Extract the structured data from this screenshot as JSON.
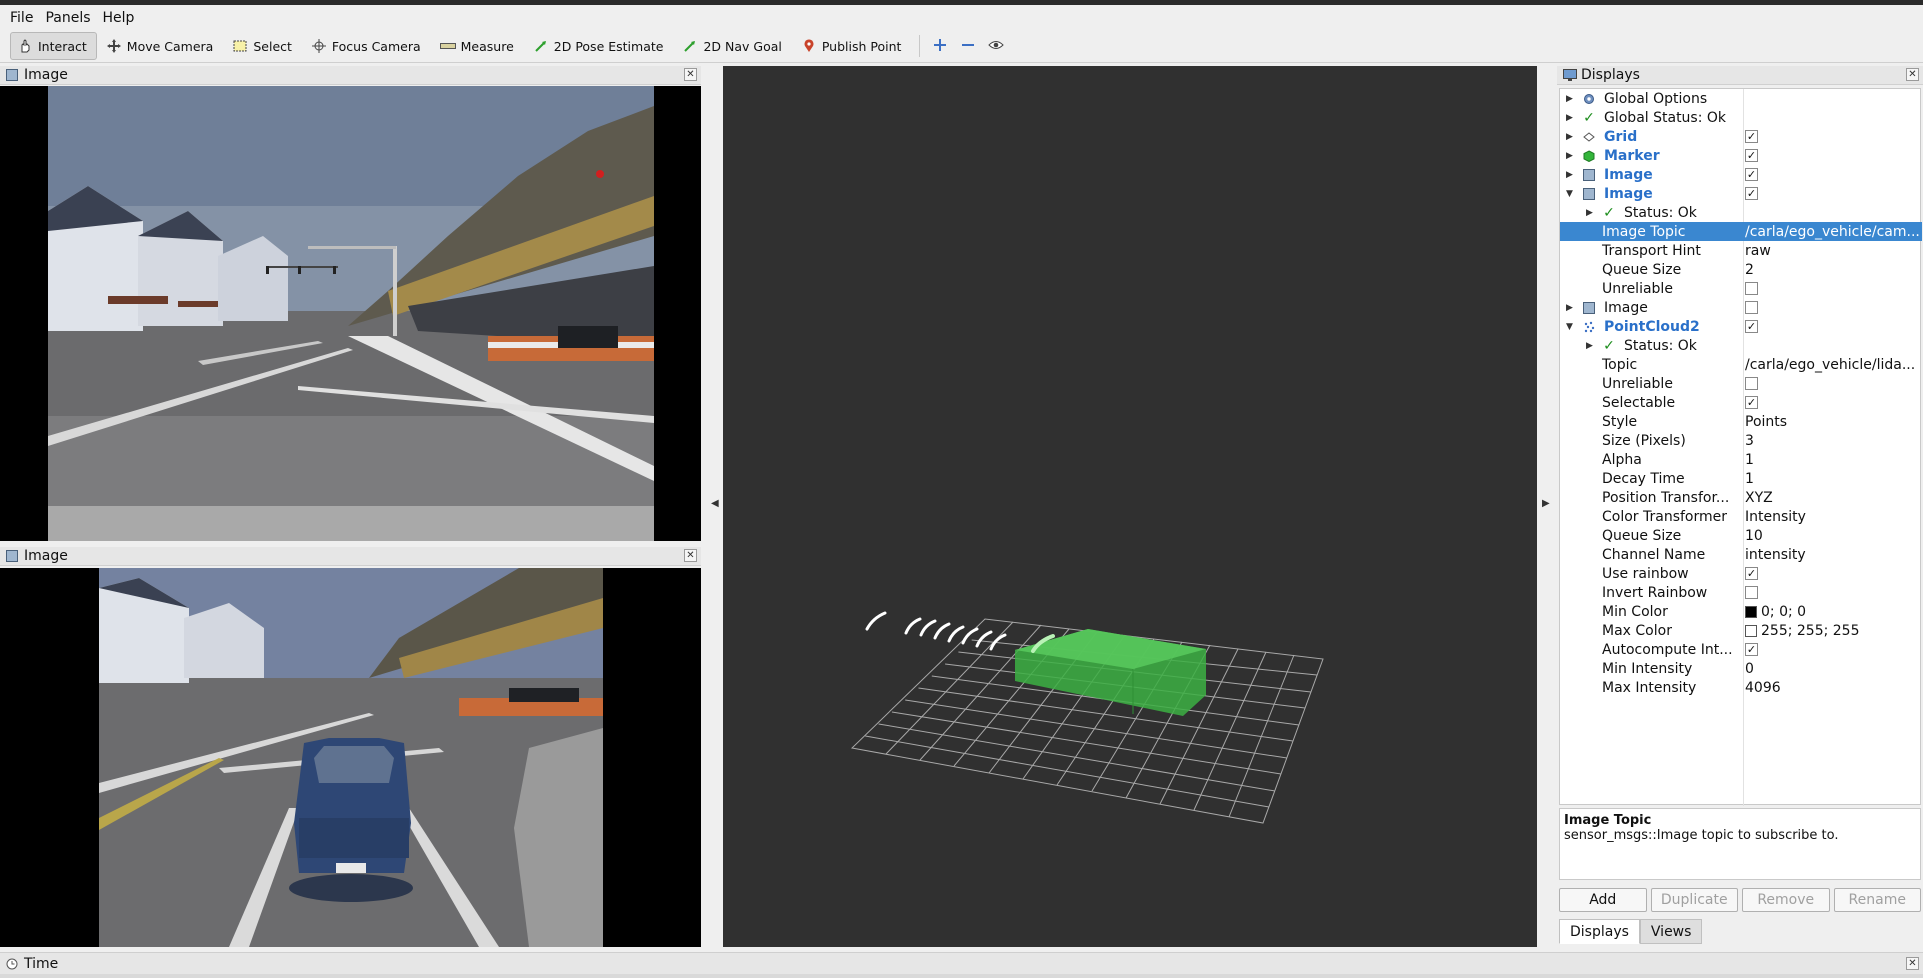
{
  "menu": {
    "file": "File",
    "panels": "Panels",
    "help": "Help"
  },
  "toolbar": {
    "interact": "Interact",
    "move_camera": "Move Camera",
    "select": "Select",
    "focus_camera": "Focus Camera",
    "measure": "Measure",
    "pose_estimate": "2D Pose Estimate",
    "nav_goal": "2D Nav Goal",
    "publish_point": "Publish Point"
  },
  "image_panel_top": {
    "title": "Image"
  },
  "image_panel_bottom": {
    "title": "Image"
  },
  "displays": {
    "title": "Displays",
    "rows": [
      {
        "label": "Global Options",
        "value": "",
        "checkbox": null
      },
      {
        "label": "Global Status: Ok",
        "value": "",
        "checkbox": null
      },
      {
        "label": "Grid",
        "value": "",
        "checkbox": true
      },
      {
        "label": "Marker",
        "value": "",
        "checkbox": true
      },
      {
        "label": "Image",
        "value": "",
        "checkbox": true
      },
      {
        "label": "Image",
        "value": "",
        "checkbox": true
      },
      {
        "label": "Status: Ok",
        "value": "",
        "checkbox": null
      },
      {
        "label": "Image Topic",
        "value": "/carla/ego_vehicle/cam...",
        "checkbox": null
      },
      {
        "label": "Transport Hint",
        "value": "raw",
        "checkbox": null
      },
      {
        "label": "Queue Size",
        "value": "2",
        "checkbox": null
      },
      {
        "label": "Unreliable",
        "value": "",
        "checkbox": false
      },
      {
        "label": "Image",
        "value": "",
        "checkbox": false
      },
      {
        "label": "PointCloud2",
        "value": "",
        "checkbox": true
      },
      {
        "label": "Status: Ok",
        "value": "",
        "checkbox": null
      },
      {
        "label": "Topic",
        "value": "/carla/ego_vehicle/lida...",
        "checkbox": null
      },
      {
        "label": "Unreliable",
        "value": "",
        "checkbox": false
      },
      {
        "label": "Selectable",
        "value": "",
        "checkbox": true
      },
      {
        "label": "Style",
        "value": "Points",
        "checkbox": null
      },
      {
        "label": "Size (Pixels)",
        "value": "3",
        "checkbox": null
      },
      {
        "label": "Alpha",
        "value": "1",
        "checkbox": null
      },
      {
        "label": "Decay Time",
        "value": "1",
        "checkbox": null
      },
      {
        "label": "Position Transfor...",
        "value": "XYZ",
        "checkbox": null
      },
      {
        "label": "Color Transformer",
        "value": "Intensity",
        "checkbox": null
      },
      {
        "label": "Queue Size",
        "value": "10",
        "checkbox": null
      },
      {
        "label": "Channel Name",
        "value": "intensity",
        "checkbox": null
      },
      {
        "label": "Use rainbow",
        "value": "",
        "checkbox": true
      },
      {
        "label": "Invert Rainbow",
        "value": "",
        "checkbox": false
      },
      {
        "label": "Min Color",
        "value": "0; 0; 0",
        "checkbox": null
      },
      {
        "label": "Max Color",
        "value": "255; 255; 255",
        "checkbox": null
      },
      {
        "label": "Autocompute Int...",
        "value": "",
        "checkbox": true
      },
      {
        "label": "Min Intensity",
        "value": "0",
        "checkbox": null
      },
      {
        "label": "Max Intensity",
        "value": "4096",
        "checkbox": null
      }
    ],
    "description_title": "Image Topic",
    "description_text": "sensor_msgs::Image topic to subscribe to.",
    "buttons": {
      "add": "Add",
      "duplicate": "Duplicate",
      "remove": "Remove",
      "rename": "Rename"
    },
    "tabs": {
      "displays": "Displays",
      "views": "Views"
    }
  },
  "time_panel": {
    "title": "Time"
  },
  "colors": {
    "selection": "#3a87d0",
    "enabled_label": "#2a70c9",
    "viewport_bg": "#303030",
    "marker_green": "#3cb043"
  }
}
